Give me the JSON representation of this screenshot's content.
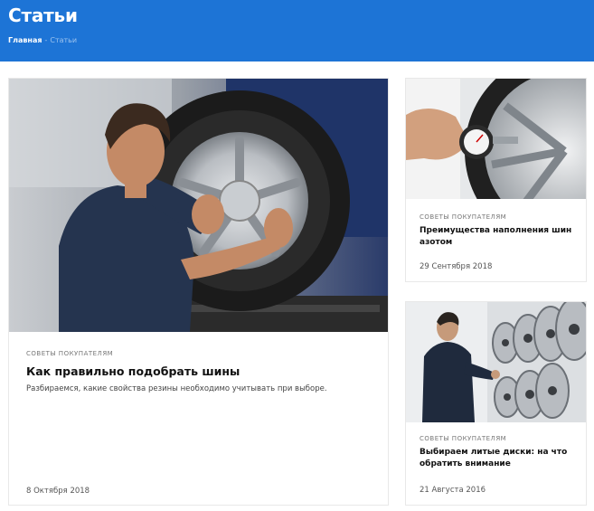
{
  "header": {
    "title": "Статьи",
    "breadcrumb": {
      "home": "Главная",
      "separator": "-",
      "current": "Статьи"
    }
  },
  "colors": {
    "header_bg": "#1d74d6",
    "breadcrumb_current": "#9cc3ef"
  },
  "articles": [
    {
      "image": "mechanic-with-tire-photo",
      "category": "СОВЕТЫ ПОКУПАТЕЛЯМ",
      "title": "Как правильно подобрать шины",
      "description": "Разбираемся, какие свойства резины необходимо учитывать при выборе.",
      "date": "8 Октября 2018"
    },
    {
      "image": "tire-pressure-gauge-photo",
      "category": "СОВЕТЫ ПОКУПАТЕЛЯМ",
      "title": "Преимущества наполнения шин азотом",
      "date": "29 Сентября 2018"
    },
    {
      "image": "alloy-wheels-showroom-photo",
      "category": "СОВЕТЫ ПОКУПАТЕЛЯМ",
      "title": "Выбираем литые диски: на что обратить внимание",
      "date": "21 Августа 2016"
    }
  ]
}
